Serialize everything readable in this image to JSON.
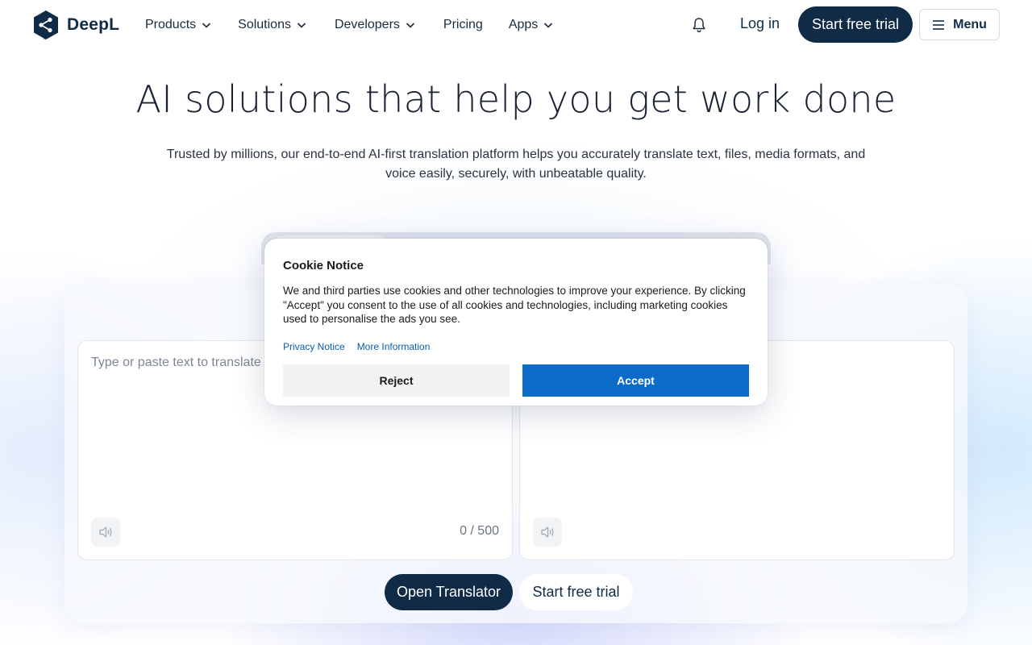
{
  "brand": {
    "name": "DeepL",
    "color": "#0f2b46",
    "icon": "deepl-logo-icon"
  },
  "nav": {
    "items": [
      {
        "label": "Products",
        "has_dropdown": true
      },
      {
        "label": "Solutions",
        "has_dropdown": true
      },
      {
        "label": "Developers",
        "has_dropdown": true
      },
      {
        "label": "Pricing",
        "has_dropdown": false
      },
      {
        "label": "Apps",
        "has_dropdown": true
      }
    ],
    "notifications_icon": "bell-icon",
    "login_label": "Log in",
    "trial_label": "Start free trial",
    "menu_label": "Menu",
    "menu_icon": "hamburger-icon"
  },
  "hero": {
    "title": "AI solutions that help you get work done",
    "subtitle": "Trusted by millions, our end-to-end AI-first translation platform helps you accurately translate text, files, media formats, and voice easily, securely, with unbeatable quality."
  },
  "translator": {
    "source_placeholder": "Type or paste text to translate",
    "char_count": "0 / 500",
    "speaker_icon": "speaker-icon",
    "open_button": "Open Translator",
    "trial_button": "Start free trial"
  },
  "cookie": {
    "title": "Cookie Notice",
    "text": "We and third parties use cookies and other technologies to improve your experience. By clicking \"Accept\" you consent to the use of all cookies and technologies, including marketing cookies used to personalise the ads you see.",
    "privacy_link": "Privacy Notice",
    "more_link": "More Information",
    "reject_label": "Reject",
    "accept_label": "Accept",
    "accept_color": "#0c6bc7"
  }
}
